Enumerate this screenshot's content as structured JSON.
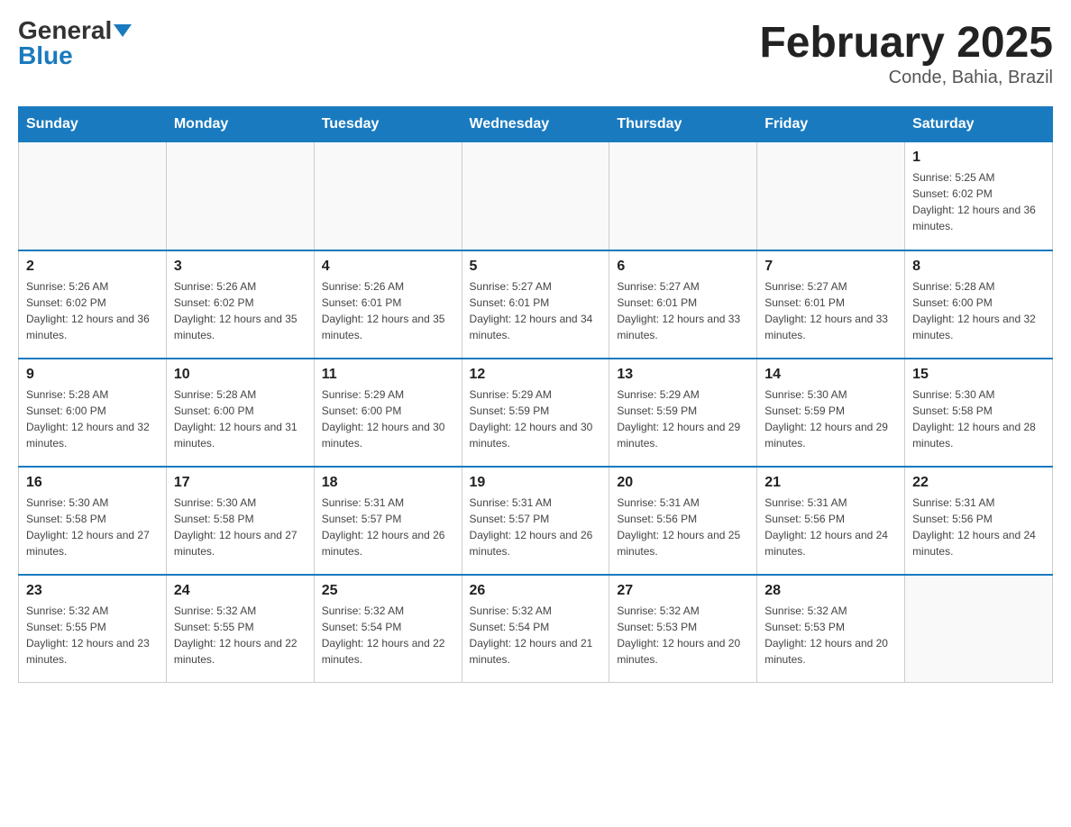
{
  "header": {
    "logo_general": "General",
    "logo_blue": "Blue",
    "month_title": "February 2025",
    "location": "Conde, Bahia, Brazil"
  },
  "days_of_week": [
    "Sunday",
    "Monday",
    "Tuesday",
    "Wednesday",
    "Thursday",
    "Friday",
    "Saturday"
  ],
  "weeks": [
    [
      {
        "day": "",
        "info": ""
      },
      {
        "day": "",
        "info": ""
      },
      {
        "day": "",
        "info": ""
      },
      {
        "day": "",
        "info": ""
      },
      {
        "day": "",
        "info": ""
      },
      {
        "day": "",
        "info": ""
      },
      {
        "day": "1",
        "info": "Sunrise: 5:25 AM\nSunset: 6:02 PM\nDaylight: 12 hours and 36 minutes."
      }
    ],
    [
      {
        "day": "2",
        "info": "Sunrise: 5:26 AM\nSunset: 6:02 PM\nDaylight: 12 hours and 36 minutes."
      },
      {
        "day": "3",
        "info": "Sunrise: 5:26 AM\nSunset: 6:02 PM\nDaylight: 12 hours and 35 minutes."
      },
      {
        "day": "4",
        "info": "Sunrise: 5:26 AM\nSunset: 6:01 PM\nDaylight: 12 hours and 35 minutes."
      },
      {
        "day": "5",
        "info": "Sunrise: 5:27 AM\nSunset: 6:01 PM\nDaylight: 12 hours and 34 minutes."
      },
      {
        "day": "6",
        "info": "Sunrise: 5:27 AM\nSunset: 6:01 PM\nDaylight: 12 hours and 33 minutes."
      },
      {
        "day": "7",
        "info": "Sunrise: 5:27 AM\nSunset: 6:01 PM\nDaylight: 12 hours and 33 minutes."
      },
      {
        "day": "8",
        "info": "Sunrise: 5:28 AM\nSunset: 6:00 PM\nDaylight: 12 hours and 32 minutes."
      }
    ],
    [
      {
        "day": "9",
        "info": "Sunrise: 5:28 AM\nSunset: 6:00 PM\nDaylight: 12 hours and 32 minutes."
      },
      {
        "day": "10",
        "info": "Sunrise: 5:28 AM\nSunset: 6:00 PM\nDaylight: 12 hours and 31 minutes."
      },
      {
        "day": "11",
        "info": "Sunrise: 5:29 AM\nSunset: 6:00 PM\nDaylight: 12 hours and 30 minutes."
      },
      {
        "day": "12",
        "info": "Sunrise: 5:29 AM\nSunset: 5:59 PM\nDaylight: 12 hours and 30 minutes."
      },
      {
        "day": "13",
        "info": "Sunrise: 5:29 AM\nSunset: 5:59 PM\nDaylight: 12 hours and 29 minutes."
      },
      {
        "day": "14",
        "info": "Sunrise: 5:30 AM\nSunset: 5:59 PM\nDaylight: 12 hours and 29 minutes."
      },
      {
        "day": "15",
        "info": "Sunrise: 5:30 AM\nSunset: 5:58 PM\nDaylight: 12 hours and 28 minutes."
      }
    ],
    [
      {
        "day": "16",
        "info": "Sunrise: 5:30 AM\nSunset: 5:58 PM\nDaylight: 12 hours and 27 minutes."
      },
      {
        "day": "17",
        "info": "Sunrise: 5:30 AM\nSunset: 5:58 PM\nDaylight: 12 hours and 27 minutes."
      },
      {
        "day": "18",
        "info": "Sunrise: 5:31 AM\nSunset: 5:57 PM\nDaylight: 12 hours and 26 minutes."
      },
      {
        "day": "19",
        "info": "Sunrise: 5:31 AM\nSunset: 5:57 PM\nDaylight: 12 hours and 26 minutes."
      },
      {
        "day": "20",
        "info": "Sunrise: 5:31 AM\nSunset: 5:56 PM\nDaylight: 12 hours and 25 minutes."
      },
      {
        "day": "21",
        "info": "Sunrise: 5:31 AM\nSunset: 5:56 PM\nDaylight: 12 hours and 24 minutes."
      },
      {
        "day": "22",
        "info": "Sunrise: 5:31 AM\nSunset: 5:56 PM\nDaylight: 12 hours and 24 minutes."
      }
    ],
    [
      {
        "day": "23",
        "info": "Sunrise: 5:32 AM\nSunset: 5:55 PM\nDaylight: 12 hours and 23 minutes."
      },
      {
        "day": "24",
        "info": "Sunrise: 5:32 AM\nSunset: 5:55 PM\nDaylight: 12 hours and 22 minutes."
      },
      {
        "day": "25",
        "info": "Sunrise: 5:32 AM\nSunset: 5:54 PM\nDaylight: 12 hours and 22 minutes."
      },
      {
        "day": "26",
        "info": "Sunrise: 5:32 AM\nSunset: 5:54 PM\nDaylight: 12 hours and 21 minutes."
      },
      {
        "day": "27",
        "info": "Sunrise: 5:32 AM\nSunset: 5:53 PM\nDaylight: 12 hours and 20 minutes."
      },
      {
        "day": "28",
        "info": "Sunrise: 5:32 AM\nSunset: 5:53 PM\nDaylight: 12 hours and 20 minutes."
      },
      {
        "day": "",
        "info": ""
      }
    ]
  ]
}
